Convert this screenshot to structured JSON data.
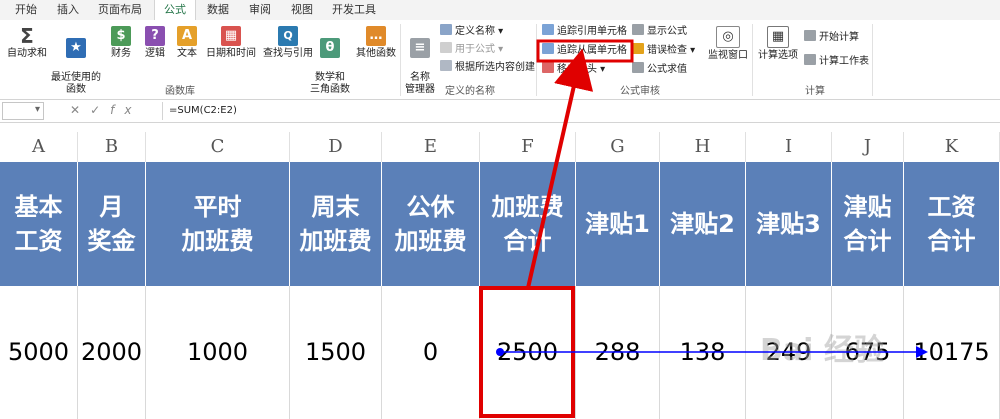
{
  "ribbon_tabs": [
    "开始",
    "插入",
    "页面布局",
    "公式",
    "数据",
    "审阅",
    "视图",
    "开发工具"
  ],
  "active_tab": "公式",
  "function_library": {
    "buttons": [
      {
        "label": "自动求和",
        "icon": "sigma-icon",
        "glyph": "Σ",
        "color": "#444444"
      },
      {
        "label": "最近使用的\n函数",
        "icon": "star-icon",
        "glyph": "★",
        "color": "#2f6db4"
      },
      {
        "label": "财务",
        "icon": "finance-icon",
        "glyph": "$",
        "color": "#4c9a58"
      },
      {
        "label": "逻辑",
        "icon": "logic-icon",
        "glyph": "?",
        "color": "#8a4fb0"
      },
      {
        "label": "文本",
        "icon": "text-icon",
        "glyph": "A",
        "color": "#e5a02a"
      },
      {
        "label": "日期和时间",
        "icon": "calendar-icon",
        "glyph": "▦",
        "color": "#d9534f"
      },
      {
        "label": "查找与引用",
        "icon": "lookup-icon",
        "glyph": "🔍",
        "color": "#2b7ab0"
      },
      {
        "label": "数学和\n三角函数",
        "icon": "math-icon",
        "glyph": "θ",
        "color": "#4c9a7a"
      },
      {
        "label": "其他函数",
        "icon": "more-functions-icon",
        "glyph": "…",
        "color": "#e08a2a"
      }
    ],
    "group_label": "函数库"
  },
  "defined_names": {
    "name_manager": "名称\n管理器",
    "items": [
      "定义名称 ▾",
      "用于公式 ▾",
      "根据所选内容创建"
    ],
    "group_label": "定义的名称"
  },
  "formula_auditing": {
    "items": [
      "追踪引用单元格",
      "追踪从属单元格",
      "移去箭头 ▾",
      "显示公式",
      "错误检查 ▾",
      "公式求值"
    ],
    "watch_window": "监视窗口",
    "group_label": "公式审核"
  },
  "calculation": {
    "options": "计算选项",
    "items": [
      "开始计算",
      "计算工作表"
    ],
    "group_label": "计算"
  },
  "formula_bar": {
    "name_box": "",
    "formula": "=SUM(C2:E2)"
  },
  "columns": [
    "A",
    "B",
    "C",
    "D",
    "E",
    "F",
    "G",
    "H",
    "I",
    "J",
    "K"
  ],
  "headers": [
    "基本\n工资",
    "月\n奖金",
    "平时\n加班费",
    "周末\n加班费",
    "公休\n加班费",
    "加班费\n合计",
    "津贴1",
    "津贴2",
    "津贴3",
    "津贴\n合计",
    "工资\n合计"
  ],
  "values": [
    "5000",
    "2000",
    "1000",
    "1500",
    "0",
    "2500",
    "288",
    "138",
    "249",
    "675",
    "10175"
  ],
  "colors": {
    "header_bg": "#5b80b8",
    "highlight_red": "#e00000",
    "arrow_blue": "#0000ff",
    "accent_green": "#217346"
  },
  "watermark": "Bai 经验"
}
